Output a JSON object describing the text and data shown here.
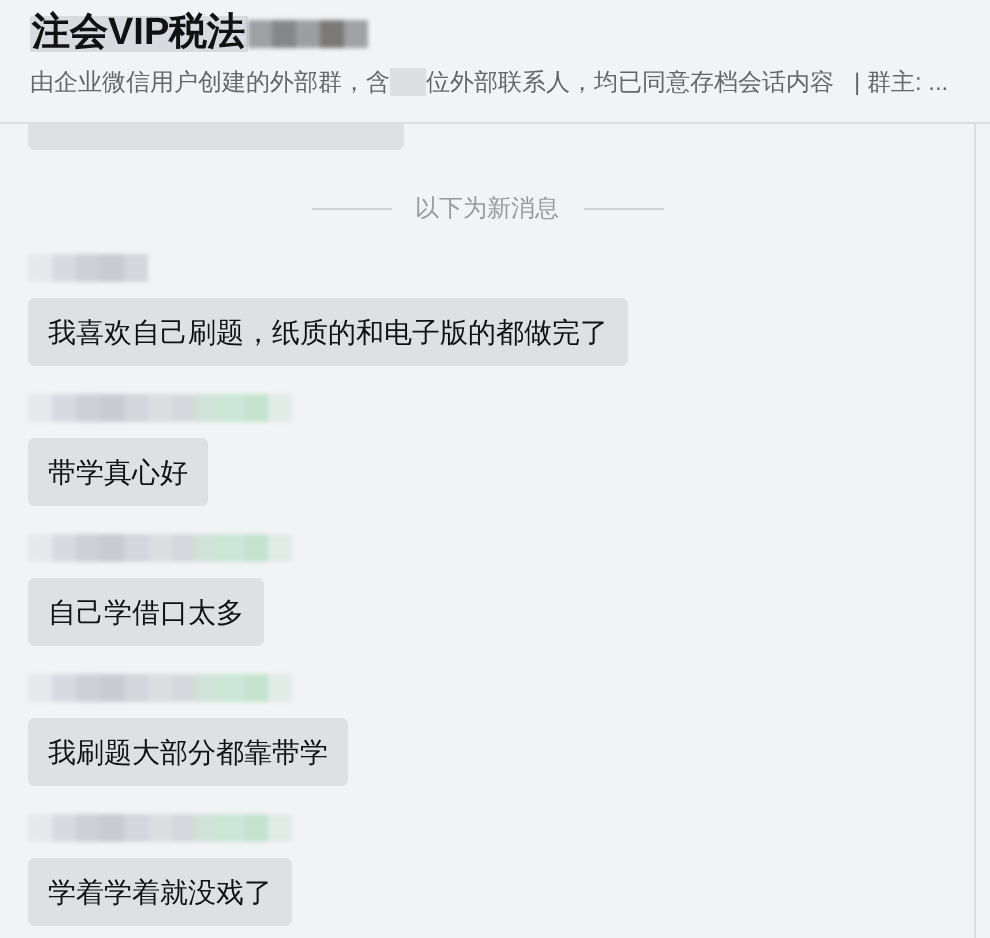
{
  "header": {
    "title": "注会VIP税法",
    "subtitle_before": "由企业微信用户创建的外部群，含",
    "subtitle_after": "位外部联系人，均已同意存档会话内容",
    "owner": "| 群主: ..."
  },
  "divider": {
    "label": "以下为新消息"
  },
  "messages": [
    {
      "text": "我喜欢自己刷题，纸质的和电子版的都做完了"
    },
    {
      "text": "带学真心好"
    },
    {
      "text": "自己学借口太多"
    },
    {
      "text": "我刷题大部分都靠带学"
    },
    {
      "text": "学着学着就没戏了"
    }
  ]
}
